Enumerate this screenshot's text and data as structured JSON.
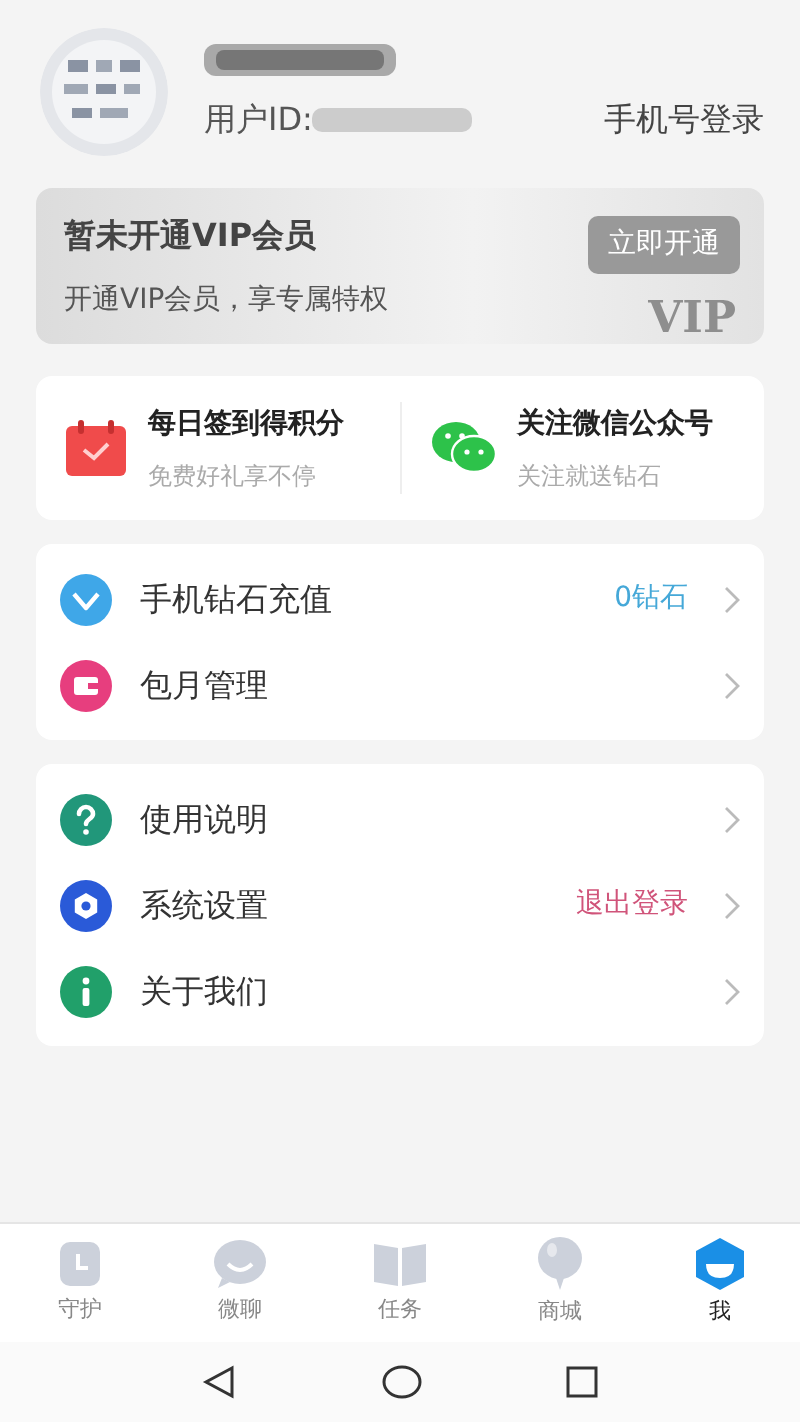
{
  "profile": {
    "id_label": "用户ID:",
    "login_link": "手机号登录"
  },
  "vip": {
    "title": "暂未开通VIP会员",
    "subtitle": "开通VIP会员，享专属特权",
    "button": "立即开通",
    "watermark": "VIP"
  },
  "promos": [
    {
      "kind": "calendar",
      "title": "每日签到得积分",
      "subtitle": "免费好礼享不停"
    },
    {
      "kind": "wechat",
      "title": "关注微信公众号",
      "subtitle": "关注就送钻石"
    }
  ],
  "menu_groups": [
    [
      {
        "kind": "diamond",
        "label": "手机钻石充值",
        "value": "0钻石",
        "color": "#45a8d8"
      },
      {
        "kind": "wallet",
        "label": "包月管理"
      }
    ],
    [
      {
        "kind": "help",
        "label": "使用说明"
      },
      {
        "kind": "settings",
        "label": "系统设置",
        "value": "退出登录",
        "color": "#d0547a"
      },
      {
        "kind": "info",
        "label": "关于我们"
      }
    ]
  ],
  "tabs": [
    {
      "kind": "clock",
      "label": "守护",
      "selected": false
    },
    {
      "kind": "chat",
      "label": "微聊",
      "selected": false
    },
    {
      "kind": "book",
      "label": "任务",
      "selected": false
    },
    {
      "kind": "balloon",
      "label": "商城",
      "selected": false
    },
    {
      "kind": "me",
      "label": "我",
      "selected": true
    }
  ]
}
